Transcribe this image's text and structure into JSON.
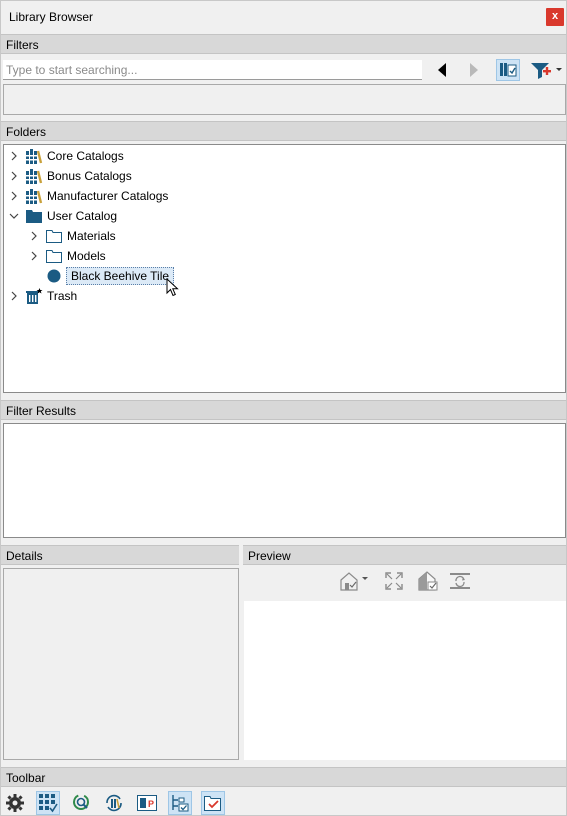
{
  "window": {
    "title": "Library Browser",
    "close_label": "x"
  },
  "sections": {
    "filters": "Filters",
    "folders": "Folders",
    "filter_results": "Filter Results",
    "details": "Details",
    "preview": "Preview",
    "toolbar": "Toolbar"
  },
  "search": {
    "placeholder": "Type to start searching...",
    "value": ""
  },
  "filter_toolbar": [
    {
      "icon": "back-arrow-icon"
    },
    {
      "icon": "forward-arrow-icon"
    },
    {
      "icon": "catalog-filter-icon",
      "active": true
    },
    {
      "icon": "add-filter-icon"
    }
  ],
  "tree": [
    {
      "label": "Core Catalogs",
      "icon": "catalog-books-icon",
      "expanded": false
    },
    {
      "label": "Bonus Catalogs",
      "icon": "catalog-books-icon",
      "expanded": false
    },
    {
      "label": "Manufacturer Catalogs",
      "icon": "catalog-books-icon",
      "expanded": false
    },
    {
      "label": "User Catalog",
      "icon": "folder-filled-icon",
      "expanded": true
    },
    {
      "label": "Materials",
      "icon": "folder-outline-icon",
      "expanded": false
    },
    {
      "label": "Models",
      "icon": "folder-outline-icon",
      "expanded": false
    },
    {
      "label": "Black Beehive Tile",
      "icon": "material-circle-icon",
      "selected": true
    },
    {
      "label": "Trash",
      "icon": "trash-icon",
      "expanded": false
    }
  ],
  "preview_toolbar": [
    {
      "icon": "camera-view-icon"
    },
    {
      "icon": "fit-view-icon"
    },
    {
      "icon": "render-view-icon"
    },
    {
      "icon": "refresh-preview-icon"
    }
  ],
  "bottom_toolbar": [
    {
      "icon": "settings-gear-icon"
    },
    {
      "icon": "grid-select-icon",
      "active": true
    },
    {
      "icon": "search-refresh-icon"
    },
    {
      "icon": "sync-catalog-icon"
    },
    {
      "icon": "display-options-icon"
    },
    {
      "icon": "tree-view-icon",
      "active": true
    },
    {
      "icon": "folder-check-icon",
      "active": true
    }
  ],
  "colors": {
    "accent_blue": "#1b5b83",
    "selection_bg": "#dceaf7",
    "active_button": "#cde3f5",
    "close_red": "#d9382c"
  }
}
